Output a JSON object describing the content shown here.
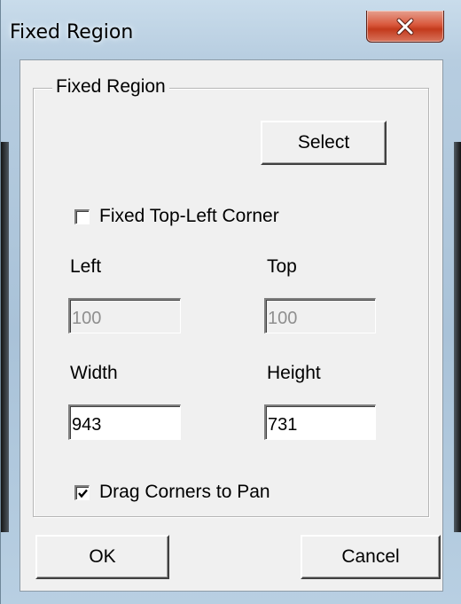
{
  "window": {
    "title": "Fixed Region",
    "close_icon": "close-x-icon",
    "accent_close": "#c33a1c"
  },
  "group": {
    "label": "Fixed Region",
    "select_label": "Select"
  },
  "fixed_top_left": {
    "label": "Fixed Top-Left Corner",
    "checked": false
  },
  "fields": {
    "left": {
      "label": "Left",
      "value": "100",
      "enabled": false
    },
    "top": {
      "label": "Top",
      "value": "100",
      "enabled": false
    },
    "width": {
      "label": "Width",
      "value": "943",
      "enabled": true
    },
    "height": {
      "label": "Height",
      "value": "731",
      "enabled": true
    }
  },
  "drag_corners": {
    "label": "Drag Corners to Pan",
    "checked": true
  },
  "buttons": {
    "ok_label": "OK",
    "cancel_label": "Cancel"
  }
}
